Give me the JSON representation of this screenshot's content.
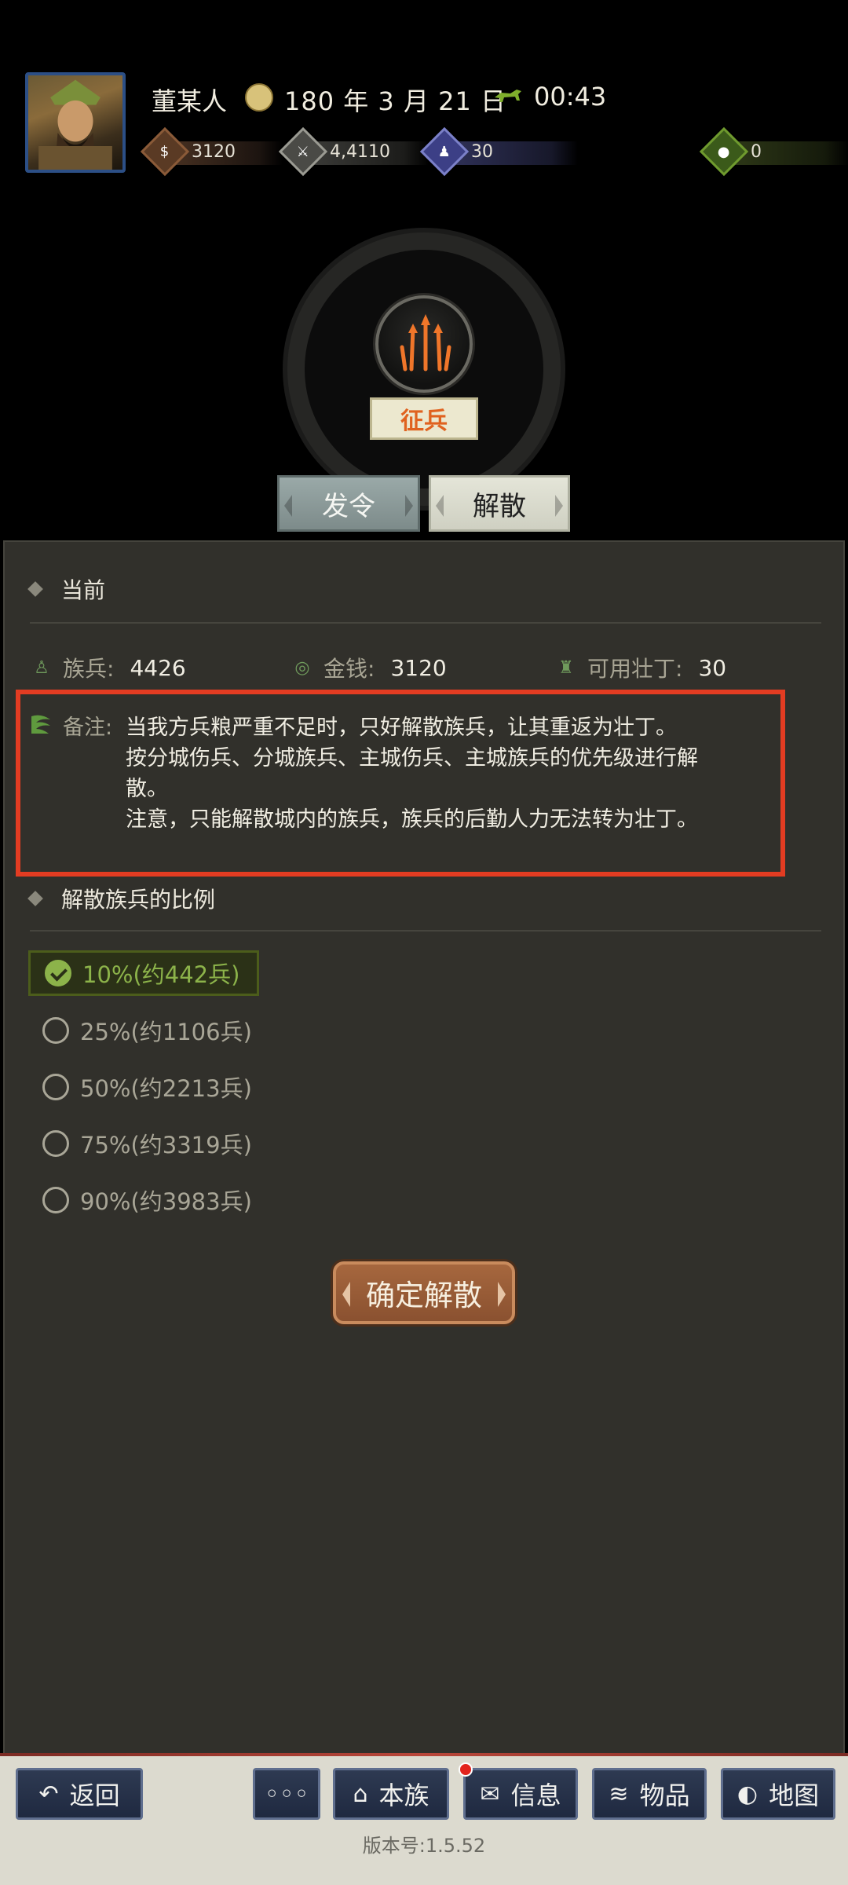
{
  "header": {
    "player_name": "董某人",
    "date": "180 年 3 月 21 日",
    "time": "00:43",
    "resources": {
      "gold": "3120",
      "troops": "4,4110",
      "manpower": "30",
      "bag": "0"
    }
  },
  "action": {
    "icon": "spear-icon",
    "label": "征兵"
  },
  "tabs": {
    "order": "发令",
    "disband": "解散"
  },
  "current": {
    "title": "当前",
    "clan_troops_label": "族兵:",
    "clan_troops_value": "4426",
    "money_label": "金钱:",
    "money_value": "3120",
    "manpower_label": "可用壮丁:",
    "manpower_value": "30"
  },
  "note": {
    "label": "备注:",
    "lines": [
      "当我方兵粮严重不足时，只好解散族兵，让其重返为壮丁。",
      "按分城伤兵、分城族兵、主城伤兵、主城族兵的优先级进行解",
      "散。",
      "注意，只能解散城内的族兵，族兵的后勤人力无法转为壮丁。"
    ]
  },
  "ratio": {
    "title": "解散族兵的比例",
    "options": [
      {
        "label": "10%(约442兵)",
        "selected": true
      },
      {
        "label": "25%(约1106兵)",
        "selected": false
      },
      {
        "label": "50%(约2213兵)",
        "selected": false
      },
      {
        "label": "75%(约3319兵)",
        "selected": false
      },
      {
        "label": "90%(约3983兵)",
        "selected": false
      }
    ]
  },
  "confirm_label": "确定解散",
  "bottom_nav": {
    "back": "返回",
    "more": "◦◦◦",
    "clan": "本族",
    "info": "信息",
    "items": "物品",
    "map": "地图"
  },
  "version": "版本号:1.5.52",
  "colors": {
    "accent_orange": "#e0621f",
    "selected_green": "#8cb34a",
    "highlight_red": "#e33c22",
    "panel_bg": "#31302b"
  }
}
